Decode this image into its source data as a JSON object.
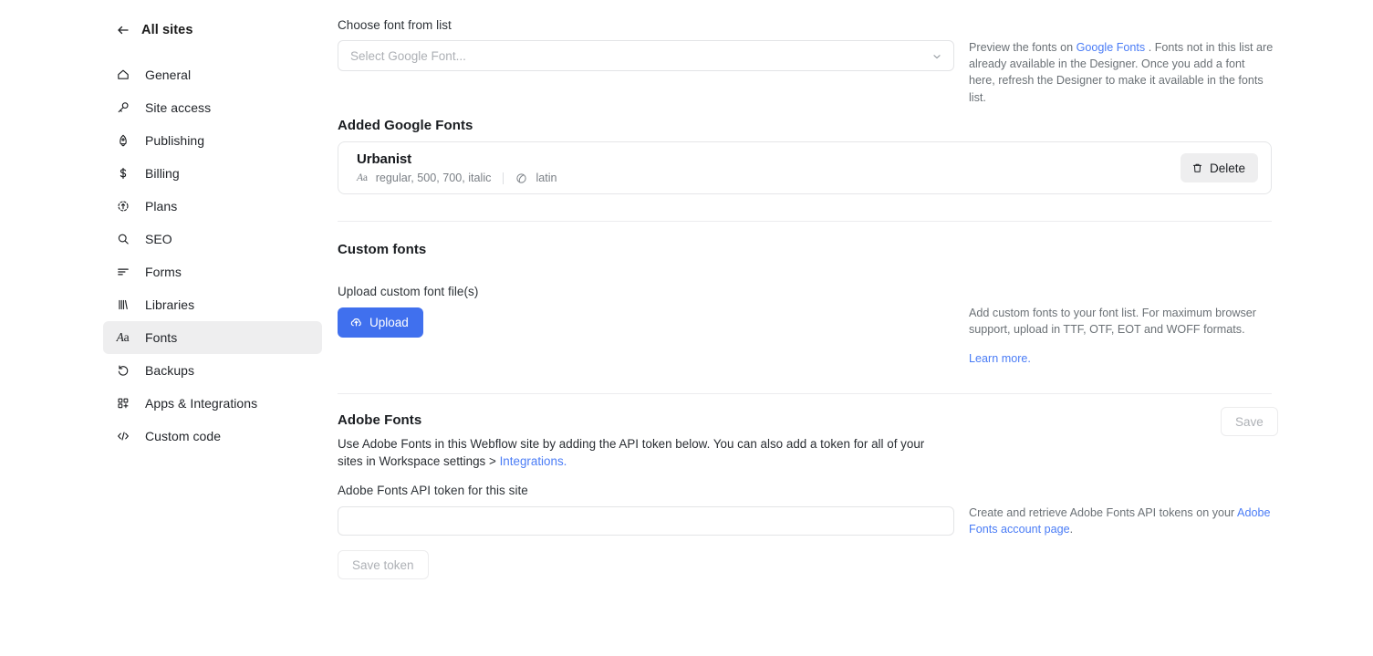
{
  "sidebar": {
    "back": {
      "label": "All sites",
      "icon": "arrow-left-icon"
    },
    "items": [
      {
        "label": "General",
        "icon": "home-icon",
        "active": false
      },
      {
        "label": "Site access",
        "icon": "key-icon",
        "active": false
      },
      {
        "label": "Publishing",
        "icon": "rocket-icon",
        "active": false
      },
      {
        "label": "Billing",
        "icon": "dollar-icon",
        "active": false
      },
      {
        "label": "Plans",
        "icon": "clock-arrow-icon",
        "active": false
      },
      {
        "label": "SEO",
        "icon": "search-icon",
        "active": false
      },
      {
        "label": "Forms",
        "icon": "form-lines-icon",
        "active": false
      },
      {
        "label": "Libraries",
        "icon": "libraries-icon",
        "active": false
      },
      {
        "label": "Fonts",
        "icon": "aa-icon",
        "active": true
      },
      {
        "label": "Backups",
        "icon": "undo-icon",
        "active": false
      },
      {
        "label": "Apps & Integrations",
        "icon": "apps-grid-icon",
        "active": false
      },
      {
        "label": "Custom code",
        "icon": "code-icon",
        "active": false
      }
    ]
  },
  "google_fonts": {
    "choose_label": "Choose font from list",
    "select_placeholder": "Select Google Font...",
    "note_prefix": "Preview the fonts on ",
    "note_link": "Google Fonts",
    "note_suffix": " . Fonts not in this list are already available in the Designer. Once you add a font here, refresh the Designer to make it available in the fonts list.",
    "added_title": "Added Google Fonts",
    "added": [
      {
        "name": "Urbanist",
        "weights": "regular, 500, 700, italic",
        "subsets": "latin",
        "delete_label": "Delete"
      }
    ]
  },
  "custom_fonts": {
    "title": "Custom fonts",
    "upload_label": "Upload custom font file(s)",
    "upload_button": "Upload",
    "note": "Add custom fonts to your font list. For maximum browser support, upload in TTF, OTF, EOT and WOFF formats.",
    "learn_more": "Learn more."
  },
  "adobe_fonts": {
    "title": "Adobe Fonts",
    "description_prefix": "Use Adobe Fonts in this Webflow site by adding the API token below. You can also add a token for all of your sites in Workspace settings > ",
    "description_link": "Integrations.",
    "save_label": "Save",
    "token_label": "Adobe Fonts API token for this site",
    "token_value": "",
    "token_placeholder": "",
    "save_token_label": "Save token",
    "note_prefix": "Create and retrieve Adobe Fonts API tokens on your ",
    "note_link": "Adobe Fonts account page",
    "note_suffix": "."
  },
  "colors": {
    "accent_blue": "#4070ee",
    "link_blue": "#4a7cf6",
    "active_bg": "#eeeeef",
    "border": "#e3e4e6",
    "divider": "#ececee",
    "text": "#22252a",
    "muted": "#6b7176"
  }
}
